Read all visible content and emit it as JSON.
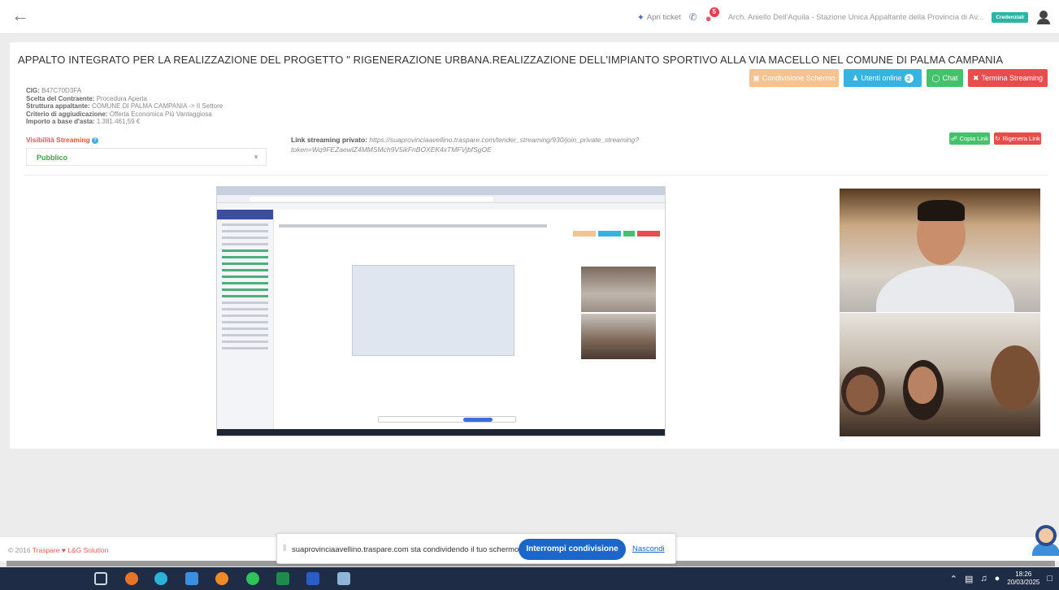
{
  "header": {
    "ticket_label": "Apri ticket",
    "notifications_count": "5",
    "user_label": "Arch. Aniello Dell'Aquila - Stazione Unica Appaltante della Provincia di Av...",
    "credentials_label": "Credenziali"
  },
  "tender": {
    "title": "APPALTO INTEGRATO PER LA REALIZZAZIONE DEL PROGETTO \" RIGENERAZIONE URBANA.REALIZZAZIONE DELL'IMPIANTO SPORTIVO ALLA VIA MACELLO NEL COMUNE DI PALMA CAMPANIA",
    "cig_label": "CIG:",
    "cig_value": "B47C70D3FA",
    "procedure_label": "Scelta del Contraente:",
    "procedure_value": "Procedura Aperta",
    "struttura_label": "Struttura appaltante:",
    "struttura_value": "COMUNE DI PALMA CAMPANIA -> II Settore",
    "criterio_label": "Criterio di aggiudicazione:",
    "criterio_value": "Offerta Economica Più Vantaggiosa",
    "importo_label": "Importo a base d'asta:",
    "importo_value": "1.381.461,59 €"
  },
  "actions": {
    "screen_share": "Condivisione Schermo",
    "users_online": "Utenti online",
    "users_online_count": "2",
    "chat": "Chat",
    "end_streaming": "Termina Streaming"
  },
  "streaming": {
    "visibility_label": "Visibilità Streaming",
    "visibility_value": "Pubblico",
    "link_label": "Link streaming privato:",
    "link_value": "https://suaprovinciaavellino.traspare.com/tender_streaming/930/join_private_streaming?token=Wq9FEZaewlZ4MMSMch9V5ikFnBOXEK4xTMFVjbfSgOE",
    "copy_link": "Copia Link",
    "regen_link": "Rigenera Link"
  },
  "footer": {
    "copyright_prefix": "© 2016",
    "traspare": "Traspare",
    "company": "L&G Solution"
  },
  "share_bar": {
    "message": "suaprovinciaavellino.traspare.com sta condividendo il tuo schermo.",
    "stop_button": "Interrompi condivisione",
    "hide_link": "Nascondi"
  },
  "taskbar": {
    "time": "18:26",
    "date": "20/03/2025"
  },
  "colors": {
    "screen_share": "#f5c290",
    "users_online": "#36b3e0",
    "chat": "#43c16b",
    "end_streaming": "#e84c4c",
    "stop_share": "#1a66c9"
  }
}
